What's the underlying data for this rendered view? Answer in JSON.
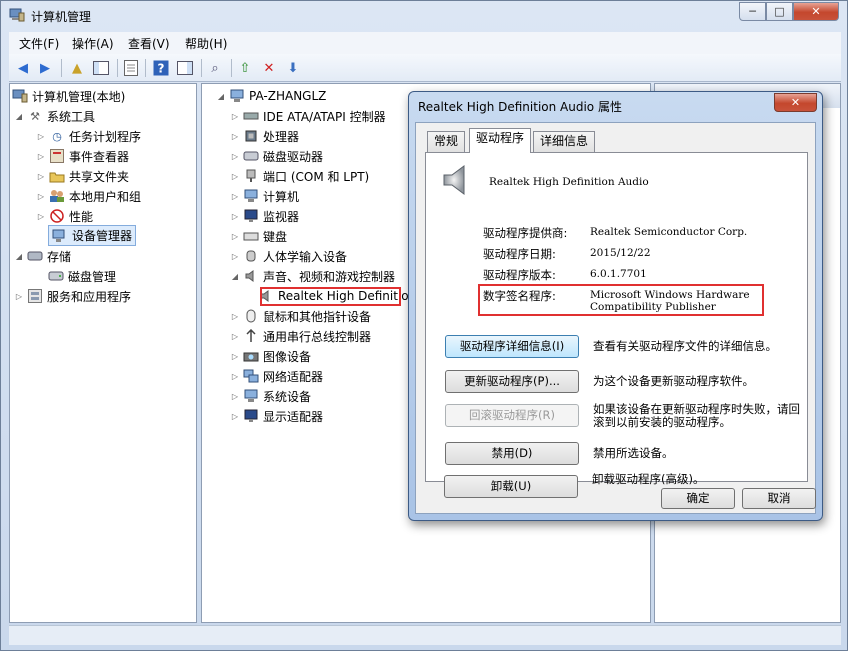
{
  "window": {
    "title": "计算机管理",
    "controls": {
      "minimize": "─",
      "maximize": "□",
      "close": "✕"
    }
  },
  "menu": [
    "文件(F)",
    "操作(A)",
    "查看(V)",
    "帮助(H)"
  ],
  "left_tree": [
    {
      "label": "计算机管理(本地)",
      "icon": "computer-management-icon"
    },
    {
      "label": "系统工具",
      "icon": "tools-icon"
    },
    {
      "label": "任务计划程序",
      "icon": "clock-icon"
    },
    {
      "label": "事件查看器",
      "icon": "event-viewer-icon"
    },
    {
      "label": "共享文件夹",
      "icon": "shared-folder-icon"
    },
    {
      "label": "本地用户和组",
      "icon": "users-icon"
    },
    {
      "label": "性能",
      "icon": "performance-icon"
    },
    {
      "label": "设备管理器",
      "icon": "device-manager-icon"
    },
    {
      "label": "存储",
      "icon": "storage-icon"
    },
    {
      "label": "磁盘管理",
      "icon": "disk-icon"
    },
    {
      "label": "服务和应用程序",
      "icon": "services-icon"
    }
  ],
  "device_tree": {
    "root": "PA-ZHANGLZ",
    "categories": [
      "IDE ATA/ATAPI 控制器",
      "处理器",
      "磁盘驱动器",
      "端口 (COM 和 LPT)",
      "计算机",
      "监视器",
      "键盘",
      "人体学输入设备",
      "声音、视频和游戏控制器",
      "Realtek High Definitio",
      "鼠标和其他指针设备",
      "通用串行总线控制器",
      "图像设备",
      "网络适配器",
      "系统设备",
      "显示适配器"
    ]
  },
  "dialog": {
    "title": "Realtek High Definition Audio 属性",
    "close": "✕",
    "tabs": [
      "常规",
      "驱动程序",
      "详细信息"
    ],
    "device_name": "Realtek High Definition Audio",
    "fields": [
      {
        "label": "驱动程序提供商:",
        "value": "Realtek Semiconductor Corp."
      },
      {
        "label": "驱动程序日期:",
        "value": "2015/12/22"
      },
      {
        "label": "驱动程序版本:",
        "value": "6.0.1.7701"
      },
      {
        "label": "数字签名程序:",
        "value": "Microsoft Windows Hardware",
        "value2": "Compatibility Publisher"
      }
    ],
    "actions": [
      {
        "button": "驱动程序详细信息(I)",
        "desc": "查看有关驱动程序文件的详细信息。"
      },
      {
        "button": "更新驱动程序(P)...",
        "desc": "为这个设备更新驱动程序软件。"
      },
      {
        "button": "回滚驱动程序(R)",
        "desc": "如果该设备在更新驱动程序时失败，请回滚到以前安装的驱动程序。"
      },
      {
        "button": "禁用(D)",
        "desc": "禁用所选设备。"
      },
      {
        "button": "卸载(U)",
        "desc": "卸载驱动程序(高级)。"
      }
    ],
    "ok": "确定",
    "cancel": "取消"
  },
  "colors": {
    "highlight": "#e03030",
    "selection": "#dcebfc"
  }
}
